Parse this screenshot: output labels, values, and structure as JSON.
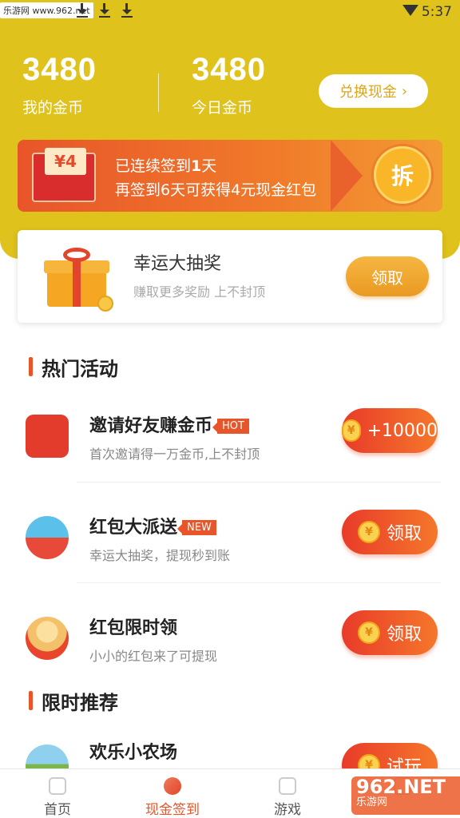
{
  "status": {
    "watermark": "乐游网 www.962.net",
    "time": "5:37"
  },
  "header": {
    "my_coins_value": "3480",
    "my_coins_label": "我的金币",
    "today_coins_value": "3480",
    "today_coins_label": "今日金币",
    "exchange_label": "兑换现金",
    "exchange_chevron": "›"
  },
  "signin": {
    "envelope_amount": "¥4",
    "line1_prefix": "已连续签到",
    "line1_days": "1",
    "line1_suffix": "天",
    "line2": "再签到6天可获得4元现金红包",
    "open_label": "拆"
  },
  "lottery": {
    "title": "幸运大抽奖",
    "subtitle": "赚取更多奖励 上不封顶",
    "button": "领取"
  },
  "sections": {
    "hot_title": "热门活动",
    "limited_title": "限时推荐"
  },
  "activities": [
    {
      "title": "邀请好友赚金币",
      "tag": "HOT",
      "subtitle": "首次邀请得一万金币,上不封顶",
      "button": "+10000",
      "icon": "red-envelope-icon"
    },
    {
      "title": "红包大派送",
      "tag": "NEW",
      "subtitle": "幸运大抽奖，提现秒到账",
      "button": "领取",
      "icon": "gift-envelope-icon"
    },
    {
      "title": "红包限时领",
      "tag": "",
      "subtitle": "小小的红包来了可提现",
      "button": "领取",
      "icon": "coin-envelope-icon"
    }
  ],
  "recommend": [
    {
      "title": "欢乐小农场",
      "button": "试玩",
      "icon": "farm-icon"
    }
  ],
  "coin_symbol": "¥",
  "tabbar": {
    "items": [
      {
        "label": "首页",
        "active": false
      },
      {
        "label": "现金签到",
        "active": true
      },
      {
        "label": "游戏",
        "active": false
      },
      {
        "label": "",
        "active": false
      }
    ]
  },
  "bottom_watermark": {
    "main": "962.NET",
    "sub": "乐游网"
  },
  "colors": {
    "header_yellow": "#e0c21c",
    "accent_orange": "#e8552a",
    "gold": "#f5b642"
  }
}
